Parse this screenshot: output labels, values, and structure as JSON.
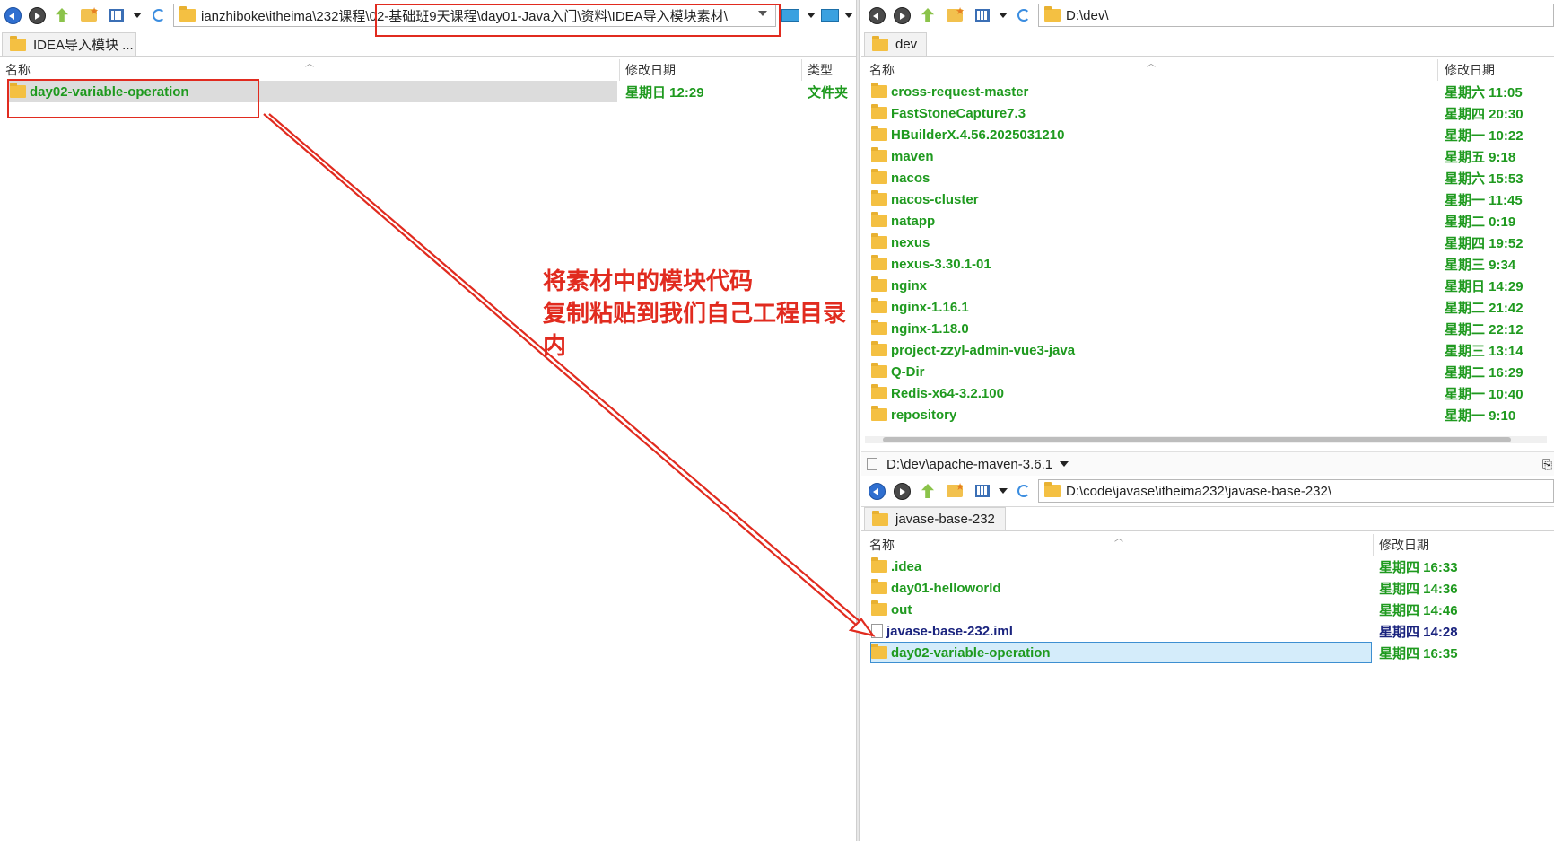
{
  "left": {
    "address": "ianzhiboke\\itheima\\232课程\\02-基础班9天课程\\day01-Java入门\\资料\\IDEA导入模块素材\\",
    "tab": "IDEA导入模块 ...",
    "columns": {
      "name": "名称",
      "date": "修改日期",
      "type": "类型"
    },
    "row": {
      "name": "day02-variable-operation",
      "date": "星期日 12:29",
      "type": "文件夹"
    }
  },
  "annotation": {
    "line1": "将素材中的模块代码",
    "line2": "复制粘贴到我们自己工程目录",
    "line3": "内"
  },
  "right_top": {
    "address": "D:\\dev\\",
    "tab": "dev",
    "columns": {
      "name": "名称",
      "date": "修改日期"
    },
    "rows": [
      {
        "name": "cross-request-master",
        "date": "星期六 11:05"
      },
      {
        "name": "FastStoneCapture7.3",
        "date": "星期四 20:30"
      },
      {
        "name": "HBuilderX.4.56.2025031210",
        "date": "星期一 10:22"
      },
      {
        "name": "maven",
        "date": "星期五 9:18"
      },
      {
        "name": "nacos",
        "date": "星期六 15:53"
      },
      {
        "name": "nacos-cluster",
        "date": "星期一 11:45"
      },
      {
        "name": "natapp",
        "date": "星期二 0:19"
      },
      {
        "name": "nexus",
        "date": "星期四 19:52"
      },
      {
        "name": "nexus-3.30.1-01",
        "date": "星期三 9:34"
      },
      {
        "name": "nginx",
        "date": "星期日 14:29"
      },
      {
        "name": "nginx-1.16.1",
        "date": "星期二 21:42"
      },
      {
        "name": "nginx-1.18.0",
        "date": "星期二 22:12"
      },
      {
        "name": "project-zzyl-admin-vue3-java",
        "date": "星期三 13:14"
      },
      {
        "name": "Q-Dir",
        "date": "星期二 16:29"
      },
      {
        "name": "Redis-x64-3.2.100",
        "date": "星期一 10:40"
      },
      {
        "name": "repository",
        "date": "星期一 9:10"
      }
    ],
    "status_path": "D:\\dev\\apache-maven-3.6.1"
  },
  "right_bottom": {
    "address": "D:\\code\\javase\\itheima232\\javase-base-232\\",
    "tab": "javase-base-232",
    "columns": {
      "name": "名称",
      "date": "修改日期"
    },
    "rows": [
      {
        "name": ".idea",
        "date": "星期四 16:33",
        "kind": "folder"
      },
      {
        "name": "day01-helloworld",
        "date": "星期四 14:36",
        "kind": "folder"
      },
      {
        "name": "out",
        "date": "星期四 14:46",
        "kind": "folder"
      },
      {
        "name": "javase-base-232.iml",
        "date": "星期四 14:28",
        "kind": "file"
      },
      {
        "name": "day02-variable-operation",
        "date": "星期四 16:35",
        "kind": "folder"
      }
    ]
  },
  "colors": {
    "accent_red": "#e12b1f",
    "folder_text": "#1f9a1f",
    "file_text": "#1a237e",
    "selection": "#d4ecfa"
  }
}
